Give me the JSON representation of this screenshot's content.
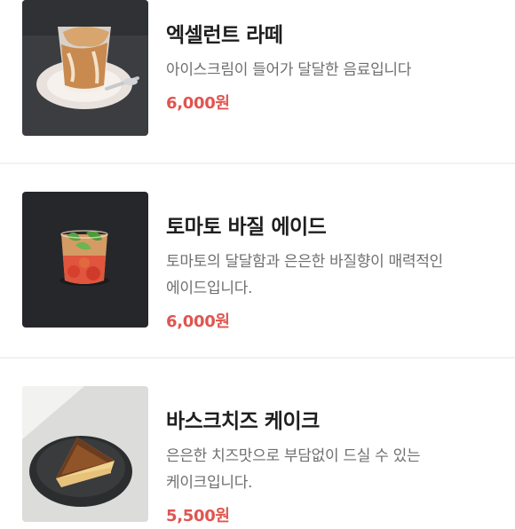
{
  "menu": {
    "items": [
      {
        "name": "엑셀런트 라떼",
        "description": "아이스크림이 들어가 달달한 음료입니다",
        "price": "6,000원",
        "image_icon": "iced-latte-photo"
      },
      {
        "name": "토마토 바질 에이드",
        "description": "토마토의 달달함과 은은한 바질향이 매력적인 에이드입니다.",
        "price": "6,000원",
        "image_icon": "tomato-basil-ade-photo"
      },
      {
        "name": "바스크치즈 케이크",
        "description": "은은한 치즈맛으로 부담없이 드실 수 있는 케이크입니다.",
        "price": "5,500원",
        "image_icon": "basque-cheesecake-photo"
      }
    ]
  },
  "colors": {
    "price": "#e0554f",
    "divider": "#f1f1f3"
  }
}
